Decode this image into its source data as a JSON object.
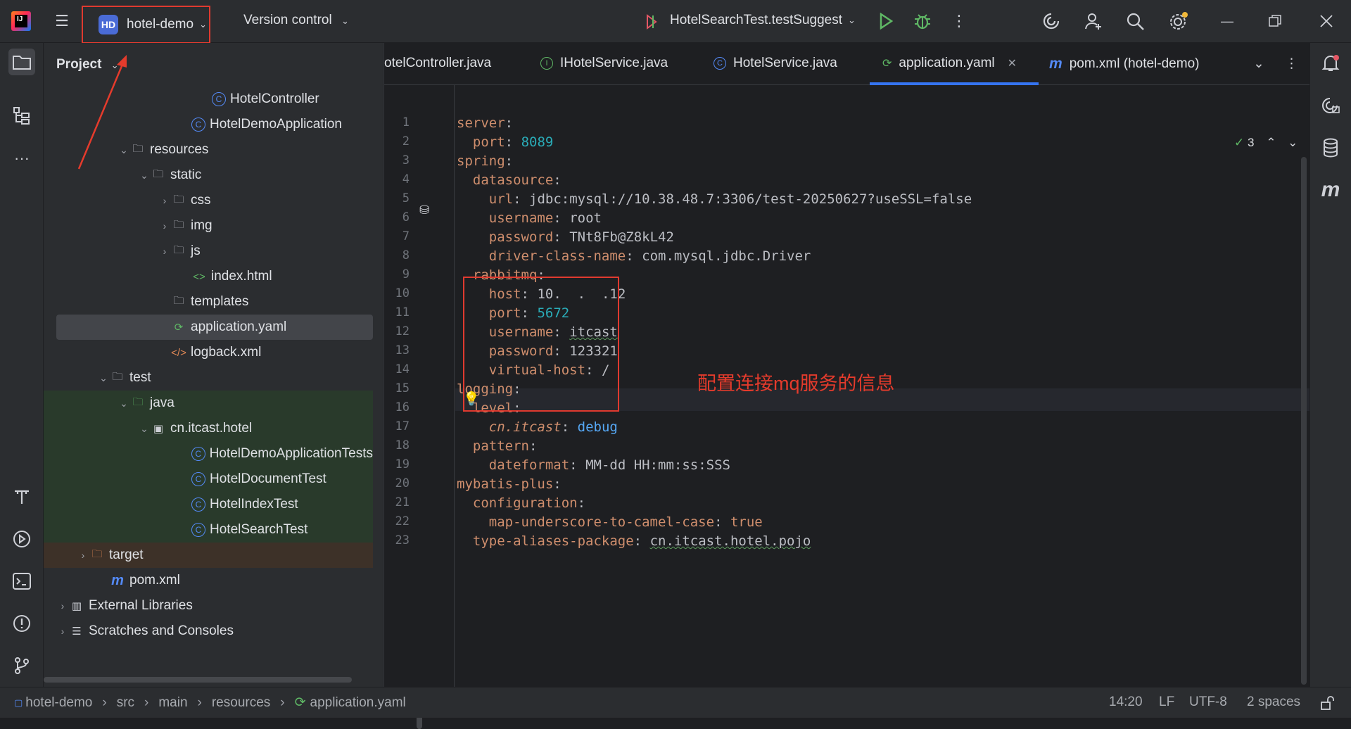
{
  "titlebar": {
    "project_badge": "HD",
    "project_name": "hotel-demo",
    "vcs_label": "Version control",
    "run_config": "HotelSearchTest.testSuggest"
  },
  "project_panel": {
    "header": "Project",
    "tree": [
      {
        "label": "HotelController",
        "icon": "class-icon"
      },
      {
        "label": "HotelDemoApplication",
        "icon": "spring-class-icon"
      },
      {
        "label": "resources",
        "icon": "folder-resources-icon"
      },
      {
        "label": "static",
        "icon": "folder-icon"
      },
      {
        "label": "css",
        "icon": "folder-icon"
      },
      {
        "label": "img",
        "icon": "folder-icon"
      },
      {
        "label": "js",
        "icon": "folder-icon"
      },
      {
        "label": "index.html",
        "icon": "html-icon"
      },
      {
        "label": "templates",
        "icon": "folder-icon"
      },
      {
        "label": "application.yaml",
        "icon": "yaml-spring-icon"
      },
      {
        "label": "logback.xml",
        "icon": "xml-icon"
      },
      {
        "label": "test",
        "icon": "folder-icon"
      },
      {
        "label": "java",
        "icon": "folder-test-icon"
      },
      {
        "label": "cn.itcast.hotel",
        "icon": "package-icon"
      },
      {
        "label": "HotelDemoApplicationTests",
        "icon": "class-icon"
      },
      {
        "label": "HotelDocumentTest",
        "icon": "test-class-icon"
      },
      {
        "label": "HotelIndexTest",
        "icon": "test-class-icon"
      },
      {
        "label": "HotelSearchTest",
        "icon": "test-class-icon"
      },
      {
        "label": "target",
        "icon": "folder-excluded-icon"
      },
      {
        "label": "pom.xml",
        "icon": "maven-icon"
      },
      {
        "label": "External Libraries",
        "icon": "library-icon"
      },
      {
        "label": "Scratches and Consoles",
        "icon": "scratches-icon"
      }
    ]
  },
  "tabs": [
    {
      "label": "otelController.java"
    },
    {
      "label": "IHotelService.java"
    },
    {
      "label": "HotelService.java"
    },
    {
      "label": "application.yaml"
    },
    {
      "label": "pom.xml (hotel-demo)"
    }
  ],
  "editor": {
    "inspection_count": "3",
    "annotation_note": "配置连接mq服务的信息",
    "line_numbers": [
      "1",
      "2",
      "3",
      "4",
      "5",
      "6",
      "7",
      "8",
      "9",
      "10",
      "11",
      "12",
      "13",
      "14",
      "15",
      "16",
      "17",
      "18",
      "19",
      "20",
      "21",
      "22",
      "23"
    ],
    "lines": [
      {
        "key": "server",
        "value": ""
      },
      {
        "key": "port",
        "value": "8089"
      },
      {
        "key": "spring",
        "value": ""
      },
      {
        "key": "datasource",
        "value": ""
      },
      {
        "key": "url",
        "value": "jdbc:mysql://10.38.48.7:3306/test-20250627?useSSL=false"
      },
      {
        "key": "username",
        "value": "root"
      },
      {
        "key": "password",
        "value": "TNt8Fb@Z8kL42"
      },
      {
        "key": "driver-class-name",
        "value": "com.mysql.jdbc.Driver"
      },
      {
        "key": "rabbitmq",
        "value": ""
      },
      {
        "key": "host",
        "value": "10.  .  .12"
      },
      {
        "key": "port",
        "value": "5672"
      },
      {
        "key": "username",
        "value": "itcast"
      },
      {
        "key": "password",
        "value": "123321"
      },
      {
        "key": "virtual-host",
        "value": "/"
      },
      {
        "key": "logging",
        "value": ""
      },
      {
        "key": "level",
        "value": ""
      },
      {
        "key": "cn.itcast",
        "value": "debug"
      },
      {
        "key": "pattern",
        "value": ""
      },
      {
        "key": "dateformat",
        "value": "MM-dd HH:mm:ss:SSS"
      },
      {
        "key": "mybatis-plus",
        "value": ""
      },
      {
        "key": "configuration",
        "value": ""
      },
      {
        "key": "map-underscore-to-camel-case",
        "value": "true"
      },
      {
        "key": "type-aliases-package",
        "value": "cn.itcast.hotel.pojo"
      }
    ]
  },
  "statusbar": {
    "breadcrumbs": [
      "hotel-demo",
      "src",
      "main",
      "resources",
      "application.yaml"
    ],
    "caret_position": "14:20",
    "line_separator": "LF",
    "encoding": "UTF-8",
    "indent": "2 spaces"
  }
}
